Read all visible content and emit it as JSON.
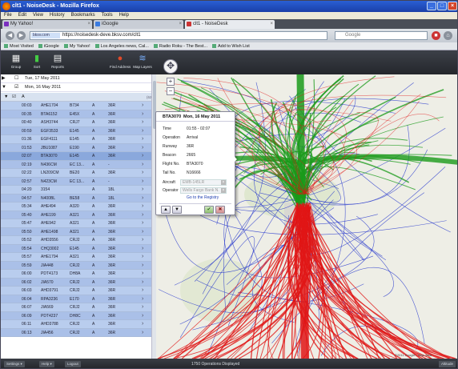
{
  "window": {
    "title": "clt1 - NoiseDesk - Mozilla Firefox",
    "controls": [
      "_",
      "□",
      "×"
    ]
  },
  "menu": [
    "File",
    "Edit",
    "View",
    "History",
    "Bookmarks",
    "Tools",
    "Help"
  ],
  "tabs": [
    {
      "label": "My Yahoo!"
    },
    {
      "label": "iGoogle"
    },
    {
      "label": "clt1 - NoiseDesk"
    }
  ],
  "nav": {
    "site_badge": "bksv.com",
    "url": "https://noisedesk-deve.bksv.com/clt1",
    "search_placeholder": "Google"
  },
  "bookmarks": [
    "Most Visited",
    "iGoogle",
    "My Yahoo!",
    "Los Angeles news, Cal...",
    "Radio Roku - The Best...",
    "Add to Wish List"
  ],
  "toolbar": {
    "items": [
      {
        "label": "Group",
        "icon": "grid-icon",
        "glyph": "▦"
      },
      {
        "label": "Sort",
        "icon": "bars-icon",
        "glyph": "▮"
      },
      {
        "label": "Reports",
        "icon": "report-icon",
        "glyph": "▤"
      },
      {
        "label": "Find Address",
        "icon": "pin-icon",
        "glyph": "●"
      },
      {
        "label": "Map Layers",
        "icon": "layers-icon",
        "glyph": "≋"
      }
    ]
  },
  "days": [
    {
      "label": "Tue, 17 May 2011",
      "expanded": false
    },
    {
      "label": "Mon, 16 May 2011",
      "expanded": true
    }
  ],
  "subgroup": {
    "label": "A",
    "count": "(62)"
  },
  "flights": [
    {
      "time": "00:03",
      "flight": "AHE1704",
      "type": "B734",
      "op": "A",
      "runway": "36R"
    },
    {
      "time": "00:35",
      "flight": "BTA6152",
      "type": "E45X",
      "op": "A",
      "runway": "36R"
    },
    {
      "time": "00:40",
      "flight": "ASH3744",
      "type": "CRJ7",
      "op": "A",
      "runway": "36R"
    },
    {
      "time": "00:59",
      "flight": "EGF3533",
      "type": "E145",
      "op": "A",
      "runway": "36R"
    },
    {
      "time": "01:36",
      "flight": "EGF4111",
      "type": "E145",
      "op": "A",
      "runway": "36R"
    },
    {
      "time": "01:53",
      "flight": "JBU1087",
      "type": "E190",
      "op": "A",
      "runway": "36R"
    },
    {
      "time": "02:07",
      "flight": "BTA3070",
      "type": "E145",
      "op": "A",
      "runway": "36R"
    },
    {
      "time": "02:19",
      "flight": "N436CM",
      "type": "EC 13...",
      "op": "A",
      "runway": "-"
    },
    {
      "time": "02:22",
      "flight": "LN209CM",
      "type": "BE20",
      "op": "A",
      "runway": "36R"
    },
    {
      "time": "02:57",
      "flight": "N423CM",
      "type": "EC 13...",
      "op": "A",
      "runway": "-"
    },
    {
      "time": "04:20",
      "flight": "3154",
      "type": "",
      "op": "A",
      "runway": "18L"
    },
    {
      "time": "04:57",
      "flight": "N400BL",
      "type": "BE58",
      "op": "A",
      "runway": "18L"
    },
    {
      "time": "05:34",
      "flight": "AHE494",
      "type": "A320",
      "op": "A",
      "runway": "36R"
    },
    {
      "time": "05:40",
      "flight": "AHE199",
      "type": "A321",
      "op": "A",
      "runway": "36R"
    },
    {
      "time": "05:47",
      "flight": "AHE942",
      "type": "A321",
      "op": "A",
      "runway": "36R"
    },
    {
      "time": "05:50",
      "flight": "AHE1498",
      "type": "A321",
      "op": "A",
      "runway": "36R"
    },
    {
      "time": "05:52",
      "flight": "AHD3556",
      "type": "CRJ2",
      "op": "A",
      "runway": "36R"
    },
    {
      "time": "05:54",
      "flight": "CHQ3002",
      "type": "E145",
      "op": "A",
      "runway": "36R"
    },
    {
      "time": "05:57",
      "flight": "AHE1794",
      "type": "A321",
      "op": "A",
      "runway": "36R"
    },
    {
      "time": "05:59",
      "flight": "JIA448",
      "type": "CRJ2",
      "op": "A",
      "runway": "36R"
    },
    {
      "time": "06:00",
      "flight": "PDT4173",
      "type": "DH8A",
      "op": "A",
      "runway": "36R"
    },
    {
      "time": "06:02",
      "flight": "JIA570",
      "type": "CRJ2",
      "op": "A",
      "runway": "36R"
    },
    {
      "time": "06:03",
      "flight": "AHD3791",
      "type": "CRJ2",
      "op": "A",
      "runway": "36R"
    },
    {
      "time": "06:04",
      "flight": "RPA3236",
      "type": "E170",
      "op": "A",
      "runway": "36R"
    },
    {
      "time": "06:07",
      "flight": "JIA569",
      "type": "CRJ2",
      "op": "A",
      "runway": "36R"
    },
    {
      "time": "06:09",
      "flight": "PDT4237",
      "type": "DH8C",
      "op": "A",
      "runway": "36R"
    },
    {
      "time": "06:11",
      "flight": "AHD3788",
      "type": "CRJ2",
      "op": "A",
      "runway": "36R"
    },
    {
      "time": "06:13",
      "flight": "JIA456",
      "type": "CRJ2",
      "op": "A",
      "runway": "36R"
    }
  ],
  "popup": {
    "flight": "BTA3070",
    "date": "Mon, 16 May 2011",
    "fields": [
      {
        "key": "Time",
        "value": "01:55 - 02:07"
      },
      {
        "key": "Operation",
        "value": "Arrival"
      },
      {
        "key": "Runway",
        "value": "36R"
      },
      {
        "key": "Beacon",
        "value": "2665"
      },
      {
        "key": "Flight No.",
        "value": "BTA3070"
      },
      {
        "key": "Tail No.",
        "value": "N16666"
      }
    ],
    "aircraft_label": "Aircraft",
    "aircraft_value": "EMB-145LR",
    "operator_label": "Operator",
    "operator_value": "Wells Fargo Bank N.",
    "registry_link": "Go to the Registry",
    "up": "▲",
    "down": "▼",
    "ok": "✔",
    "cancel": "✖"
  },
  "status": {
    "settings": "Settings ▾",
    "help": "Help ▾",
    "logout": "Logout",
    "message": "1750 Operations Displayed",
    "altitude": "Altitude",
    "map_copy": "©2011 Google - Map data"
  },
  "colors": {
    "arrivals": "#e01515",
    "departures": "#1a9a1a",
    "overflights": "#2233cc"
  }
}
